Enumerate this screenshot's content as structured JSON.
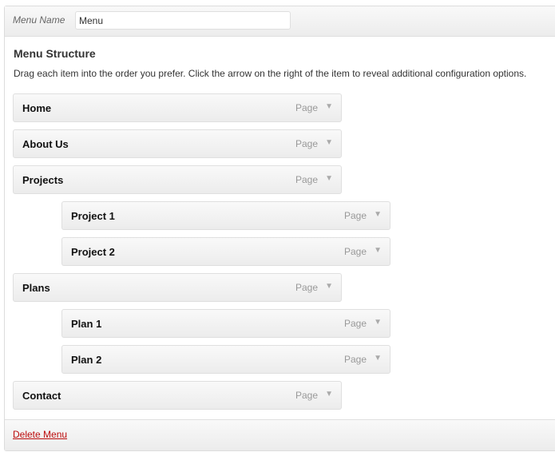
{
  "header": {
    "menu_name_label": "Menu Name",
    "menu_name_value": "Menu"
  },
  "structure": {
    "title": "Menu Structure",
    "description": "Drag each item into the order you prefer. Click the arrow on the right of the item to reveal additional configuration options."
  },
  "items": [
    {
      "label": "Home",
      "type": "Page",
      "level": 0
    },
    {
      "label": "About Us",
      "type": "Page",
      "level": 0
    },
    {
      "label": "Projects",
      "type": "Page",
      "level": 0
    },
    {
      "label": "Project 1",
      "type": "Page",
      "level": 1
    },
    {
      "label": "Project 2",
      "type": "Page",
      "level": 1
    },
    {
      "label": "Plans",
      "type": "Page",
      "level": 0
    },
    {
      "label": "Plan 1",
      "type": "Page",
      "level": 1
    },
    {
      "label": "Plan 2",
      "type": "Page",
      "level": 1
    },
    {
      "label": "Contact",
      "type": "Page",
      "level": 0
    }
  ],
  "footer": {
    "delete_label": "Delete Menu"
  },
  "colors": {
    "delete_link": "#bc0b0b"
  },
  "icons": {
    "expand": "triangle-down-icon"
  }
}
